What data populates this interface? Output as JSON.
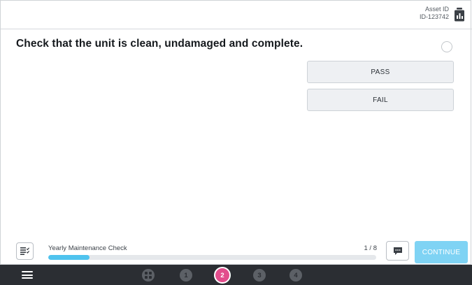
{
  "header": {
    "asset_label": "Asset ID",
    "asset_id": "ID-123742",
    "asset_icon": "asset-tag-icon"
  },
  "question": {
    "text": "Check that the unit is clean, undamaged and complete.",
    "answered": false
  },
  "options": [
    {
      "label": "PASS"
    },
    {
      "label": "FAIL"
    }
  ],
  "footer": {
    "check_title": "Yearly Maintenance Check",
    "progress_text": "1 / 8",
    "progress_fraction": 0.125,
    "continue_label": "CONTINUE",
    "continue_color": "#7fd3f4",
    "progress_color": "#4fc3ee"
  },
  "nav": {
    "menu_icon": "hamburger-menu-icon",
    "overview_icon": "grid-overview-icon",
    "steps": [
      "1",
      "2",
      "3",
      "4"
    ],
    "active_step": "2",
    "active_color": "#e24d8c"
  }
}
